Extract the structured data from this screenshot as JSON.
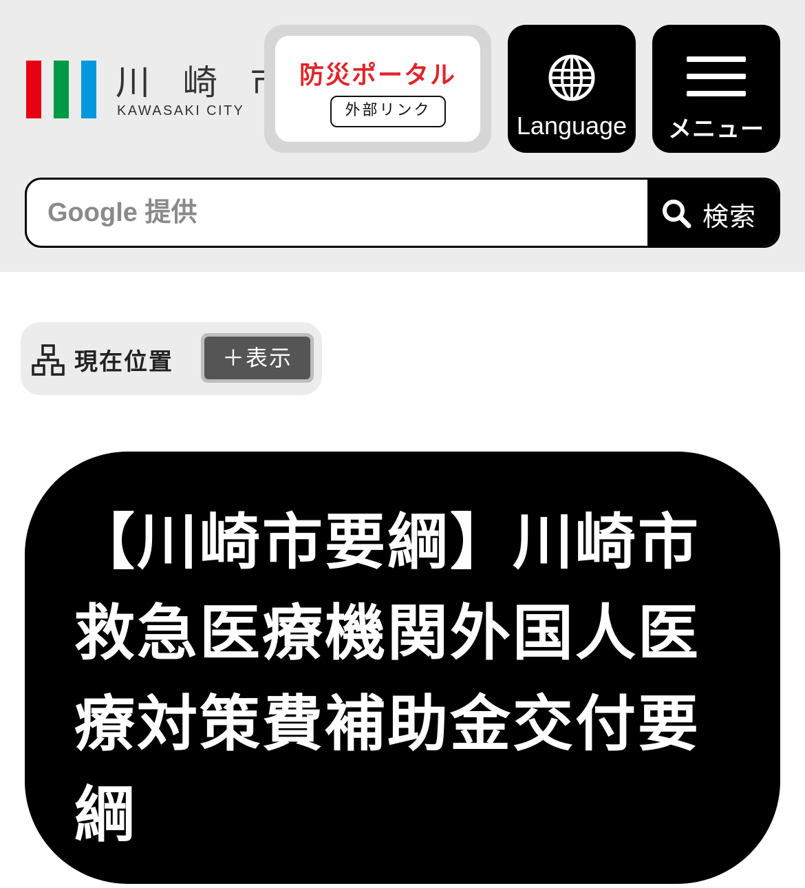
{
  "header": {
    "logo": {
      "kanji": "川 崎 市",
      "roman": "KAWASAKI CITY",
      "bar_colors": [
        "#e60012",
        "#009944",
        "#0098dc"
      ]
    },
    "disaster_portal": {
      "label": "防災ポータル",
      "external_badge": "外部リンク",
      "label_color": "#e0252b"
    },
    "language_button": {
      "label": "Language",
      "icon": "globe-icon"
    },
    "menu_button": {
      "label": "メニュー",
      "icon": "hamburger-icon"
    },
    "search": {
      "placeholder": "Google 提供",
      "value": "",
      "button_label": "検索",
      "icon": "search-icon"
    }
  },
  "breadcrumb": {
    "icon": "sitemap-icon",
    "label": "現在位置",
    "toggle_label": "＋表示"
  },
  "page": {
    "title": "【川崎市要綱】川崎市救急医療機関外国人医療対策費補助金交付要綱"
  }
}
